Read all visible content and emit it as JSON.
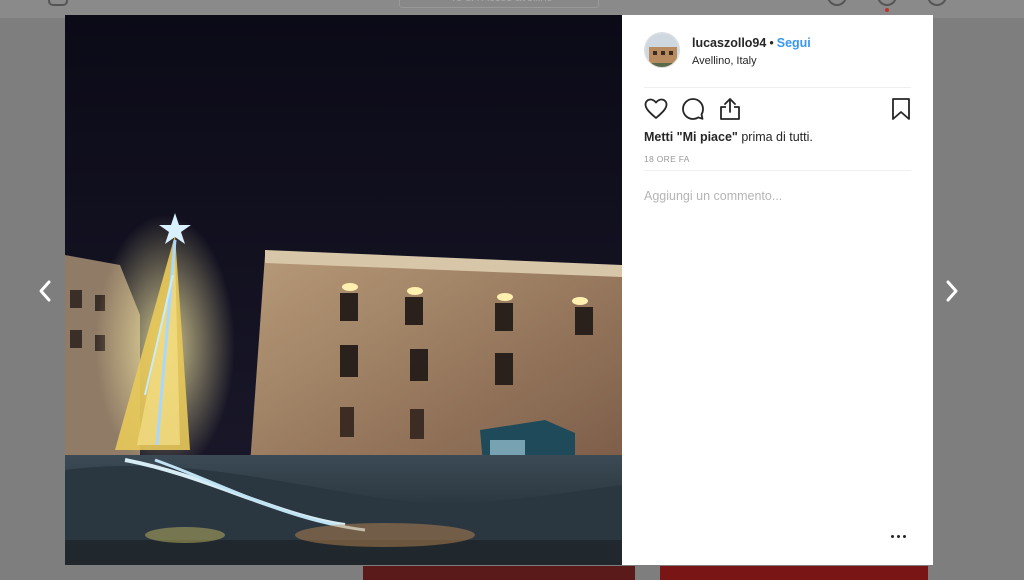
{
  "background": {
    "search_placeholder": "◦ ro di i Aosse avellino",
    "colors": {
      "overlay": "#7e7e7e",
      "notification": "#c03030"
    }
  },
  "navigation": {
    "prev_icon": "chevron-left-icon",
    "next_icon": "chevron-right-icon"
  },
  "post": {
    "photo_icon": "night-street-christmas-tree-photo",
    "header": {
      "username": "lucaszollo94",
      "separator": "•",
      "follow_label": "Segui",
      "location": "Avellino, Italy"
    },
    "actions": {
      "like_icon": "heart-icon",
      "comment_icon": "comment-icon",
      "share_icon": "share-icon",
      "save_icon": "bookmark-icon"
    },
    "likes": {
      "prefix": "Metti",
      "highlight": "\"Mi piace\"",
      "suffix": "prima di tutti."
    },
    "timestamp": "18 ORE FA",
    "comment": {
      "placeholder": "Aggiungi un commento..."
    },
    "more_icon": "more-options-icon",
    "colors": {
      "link": "#3897f0",
      "text": "#262626",
      "muted": "#999999"
    }
  }
}
